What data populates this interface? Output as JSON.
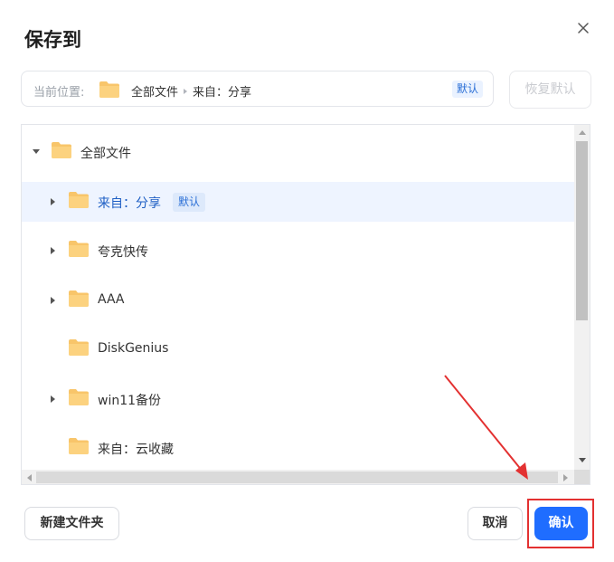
{
  "dialog": {
    "title": "保存到"
  },
  "location": {
    "label": "当前位置:",
    "path_root": "全部文件",
    "path_current": "来自：分享",
    "badge": "默认"
  },
  "restore_button": "恢复默认",
  "tree": {
    "items": [
      {
        "label": "全部文件",
        "expanded": true
      },
      {
        "label": "来自：分享",
        "badge": "默认",
        "selected": true
      },
      {
        "label": "夸克快传"
      },
      {
        "label": "AAA"
      },
      {
        "label": "DiskGenius"
      },
      {
        "label": "win11备份"
      },
      {
        "label": "来自：云收藏"
      }
    ]
  },
  "footer": {
    "new_folder": "新建文件夹",
    "cancel": "取消",
    "confirm": "确认"
  },
  "colors": {
    "accent": "#1f6dff",
    "folder": "#f8c56a",
    "annotation": "#e33131"
  }
}
